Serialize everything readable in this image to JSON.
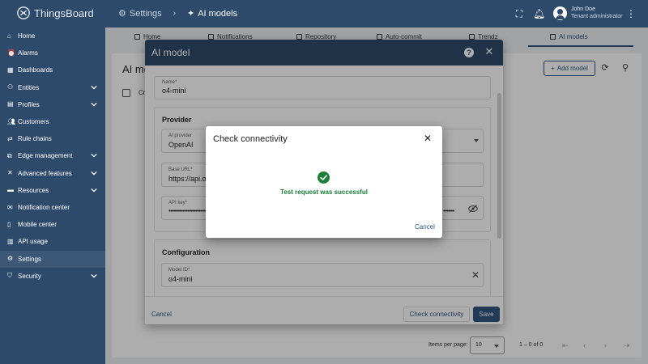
{
  "topbar": {
    "logo_text": "ThingsBoard",
    "breadcrumbs": [
      {
        "label": "Settings",
        "icon": "gear-icon"
      },
      {
        "label": "AI models",
        "icon": "sparkle-icon"
      }
    ],
    "icons": [
      "fullscreen-icon",
      "bell-icon",
      "more-vert-icon"
    ],
    "user": {
      "name": "John Doe",
      "role": "Tenant administrator"
    }
  },
  "sidebar": {
    "items": [
      {
        "label": "Home",
        "icon": "home-icon",
        "expandable": false
      },
      {
        "label": "Alarms",
        "icon": "alarm-icon",
        "expandable": false
      },
      {
        "label": "Dashboards",
        "icon": "dashboards-icon",
        "expandable": false
      },
      {
        "label": "Entities",
        "icon": "entities-icon",
        "expandable": true
      },
      {
        "label": "Profiles",
        "icon": "profiles-icon",
        "expandable": true
      },
      {
        "label": "Customers",
        "icon": "customers-icon",
        "expandable": false
      },
      {
        "label": "Rule chains",
        "icon": "rule-chains-icon",
        "expandable": false
      },
      {
        "label": "Edge management",
        "icon": "edge-icon",
        "expandable": true
      },
      {
        "label": "Advanced features",
        "icon": "tools-icon",
        "expandable": true
      },
      {
        "label": "Resources",
        "icon": "folder-icon",
        "expandable": true
      },
      {
        "label": "Notification center",
        "icon": "notification-icon",
        "expandable": false
      },
      {
        "label": "Mobile center",
        "icon": "mobile-icon",
        "expandable": false
      },
      {
        "label": "API usage",
        "icon": "api-icon",
        "expandable": false
      },
      {
        "label": "Settings",
        "icon": "gear-icon",
        "expandable": false,
        "active": true
      },
      {
        "label": "Security",
        "icon": "shield-icon",
        "expandable": true
      }
    ]
  },
  "background": {
    "tabs": [
      {
        "label": "Home"
      },
      {
        "label": "Notifications"
      },
      {
        "label": "Repository"
      },
      {
        "label": "Auto-commit"
      },
      {
        "label": "Trendz"
      },
      {
        "label": "AI models",
        "active": true
      }
    ],
    "page_title": "AI mo",
    "add_button": "Add model",
    "column_header": "Cr",
    "pager": {
      "items_label": "Items per page:",
      "page_size": "10",
      "range": "1 – 0 of 0"
    }
  },
  "ai_model_dialog": {
    "title": "AI model",
    "name_field": {
      "label": "Name*",
      "value": "o4-mini"
    },
    "provider_section": {
      "title": "Provider",
      "ai_provider": {
        "label": "AI provider",
        "value": "OpenAI"
      },
      "base_url": {
        "label": "Base URL*",
        "value": "https://api.o"
      },
      "api_key": {
        "label": "API key*",
        "value": "••••••••••••••••••••••••••••••••••",
        "value_tail": "•••••••"
      }
    },
    "configuration_section": {
      "title": "Configuration",
      "model_id": {
        "label": "Model ID*",
        "value": "o4-mini"
      }
    },
    "footer": {
      "cancel": "Cancel",
      "check_connectivity": "Check connectivity",
      "save": "Save"
    }
  },
  "connectivity_dialog": {
    "title": "Check connectivity",
    "message": "Test request was successful",
    "cancel": "Cancel",
    "colors": {
      "success": "#198038"
    }
  },
  "colors": {
    "primary": "#305680",
    "header": "#2e4a6b"
  }
}
